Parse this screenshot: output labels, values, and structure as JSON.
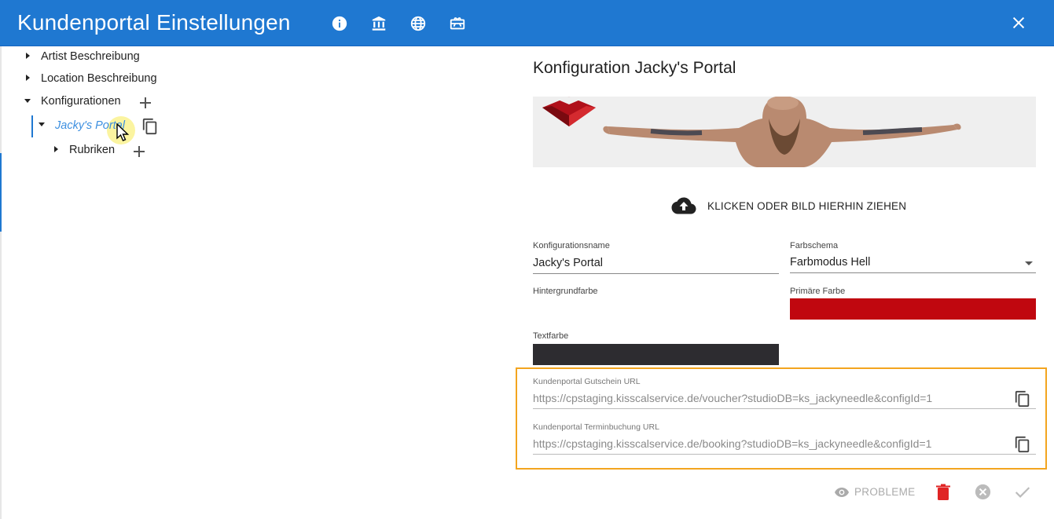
{
  "header": {
    "title": "Kundenportal Einstellungen",
    "icons": [
      "info-icon",
      "bank-icon",
      "globe-icon",
      "gift-card-icon"
    ],
    "close_icon": "close-icon",
    "color": "#1f78d1"
  },
  "tree": {
    "items": [
      {
        "label": "Artist Beschreibung",
        "expanded": false
      },
      {
        "label": "Location Beschreibung",
        "expanded": false
      },
      {
        "label": "Konfigurationen",
        "expanded": true
      },
      {
        "label": "Jacky's Portal",
        "expanded": true,
        "selected": true
      },
      {
        "label": "Rubriken",
        "expanded": false
      }
    ]
  },
  "panel": {
    "title": "Konfiguration Jacky's Portal",
    "upload_label": "KLICKEN ODER BILD HIERHIN ZIEHEN",
    "fields": {
      "config_name": {
        "label": "Konfigurationsname",
        "value": "Jacky's Portal"
      },
      "color_scheme": {
        "label": "Farbschema",
        "value": "Farbmodus Hell"
      },
      "background_color": {
        "label": "Hintergrundfarbe",
        "value": "#ffffff"
      },
      "primary_color": {
        "label": "Primäre Farbe",
        "value": "#c0070f"
      },
      "text_color": {
        "label": "Textfarbe",
        "value": "#2d2c30"
      }
    },
    "urls": [
      {
        "label": "Kundenportal Gutschein URL",
        "value": "https://cpstaging.kisscalservice.de/voucher?studioDB=ks_jackyneedle&configId=1"
      },
      {
        "label": "Kundenportal Terminbuchung URL",
        "value": "https://cpstaging.kisscalservice.de/booking?studioDB=ks_jackyneedle&configId=1"
      }
    ],
    "highlight_color": "#f3a51f"
  },
  "footer": {
    "probleme_label": "PROBLEME",
    "delete_color": "#e02424"
  }
}
